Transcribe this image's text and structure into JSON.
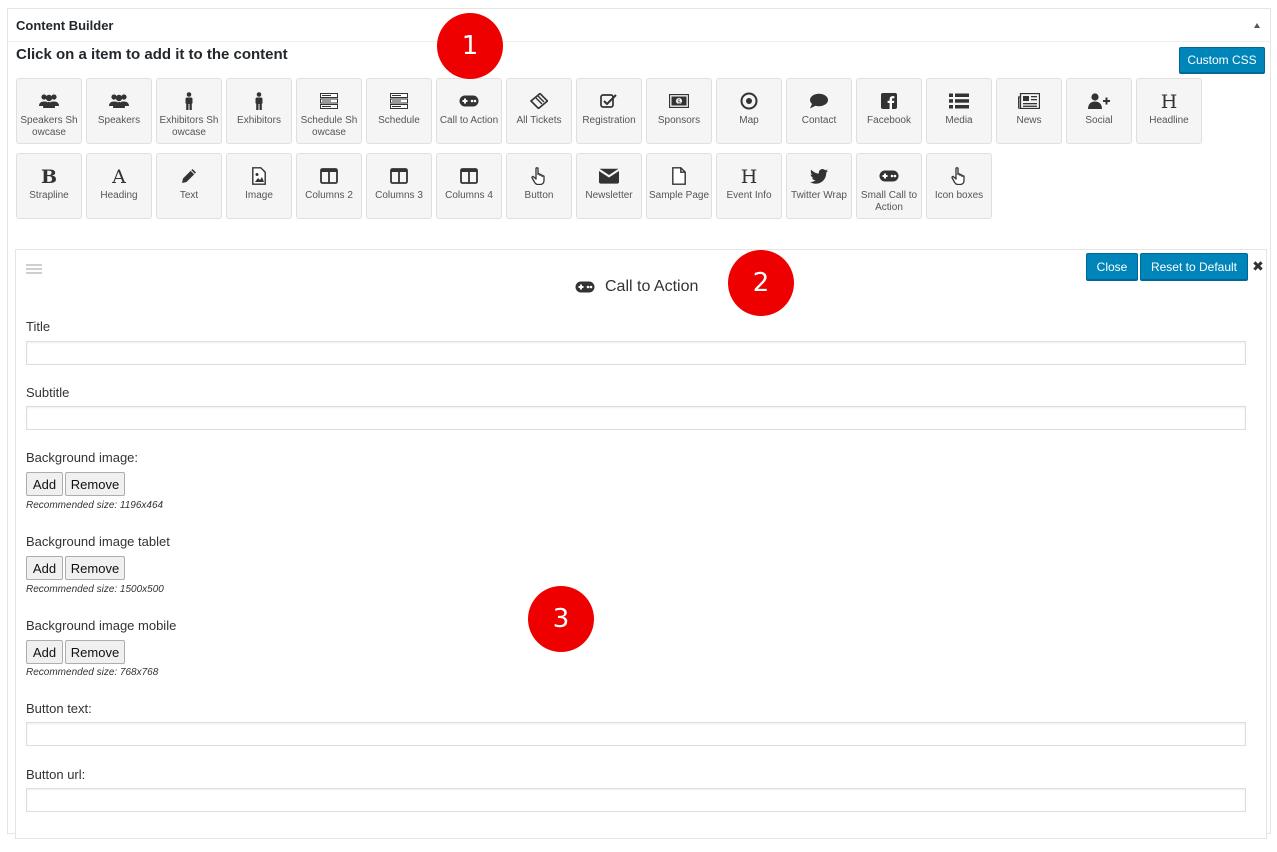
{
  "panel": {
    "title": "Content Builder"
  },
  "instruction": "Click on a item to add it to the content",
  "custom_css_label": "Custom CSS",
  "tiles_row1": [
    {
      "label": "Speakers Showcase",
      "icon": "users-icon"
    },
    {
      "label": "Speakers",
      "icon": "users-icon"
    },
    {
      "label": "Exhibitors Showcase",
      "icon": "person-icon"
    },
    {
      "label": "Exhibitors",
      "icon": "person-icon"
    },
    {
      "label": "Schedule Showcase",
      "icon": "server-icon"
    },
    {
      "label": "Schedule",
      "icon": "server-icon"
    },
    {
      "label": "Call to Action",
      "icon": "gamepad-icon"
    },
    {
      "label": "All Tickets",
      "icon": "ticket-icon"
    },
    {
      "label": "Registration",
      "icon": "checkbox-icon"
    },
    {
      "label": "Sponsors",
      "icon": "money-icon"
    },
    {
      "label": "Map",
      "icon": "target-icon"
    },
    {
      "label": "Contact",
      "icon": "comment-icon"
    },
    {
      "label": "Facebook",
      "icon": "facebook-icon"
    },
    {
      "label": "Media",
      "icon": "list-icon"
    },
    {
      "label": "News",
      "icon": "newspaper-icon"
    },
    {
      "label": "Social",
      "icon": "user-plus-icon"
    },
    {
      "label": "Headline",
      "icon": "header-icon"
    }
  ],
  "tiles_row2": [
    {
      "label": "Strapline",
      "icon": "bold-icon"
    },
    {
      "label": "Heading",
      "icon": "font-icon"
    },
    {
      "label": "Text",
      "icon": "pencil-icon"
    },
    {
      "label": "Image",
      "icon": "image-icon"
    },
    {
      "label": "Columns 2",
      "icon": "columns-icon"
    },
    {
      "label": "Columns 3",
      "icon": "columns-icon"
    },
    {
      "label": "Columns 4",
      "icon": "columns-icon"
    },
    {
      "label": "Button",
      "icon": "pointer-icon"
    },
    {
      "label": "Newsletter",
      "icon": "envelope-icon"
    },
    {
      "label": "Sample Page",
      "icon": "file-icon"
    },
    {
      "label": "Event Info",
      "icon": "header-icon"
    },
    {
      "label": "Twitter Wrap",
      "icon": "twitter-icon"
    },
    {
      "label": "Small Call to Action",
      "icon": "gamepad-icon"
    },
    {
      "label": "Icon boxes",
      "icon": "pointer-icon"
    }
  ],
  "badges": [
    "1",
    "2",
    "3"
  ],
  "editor": {
    "title": "Call to Action",
    "title_icon": "gamepad-icon",
    "close_label": "Close",
    "reset_label": "Reset to Default",
    "close_x": "✖",
    "fields": {
      "title_label": "Title",
      "title_value": "",
      "subtitle_label": "Subtitle",
      "subtitle_value": "",
      "bg_label": "Background image:",
      "bg_hint": "Recommended size: 1196x464",
      "bg_tablet_label": "Background image tablet",
      "bg_tablet_hint": "Recommended size: 1500x500",
      "bg_mobile_label": "Background image mobile",
      "bg_mobile_hint": "Recommended size: 768x768",
      "add_label": "Add",
      "remove_label": "Remove",
      "button_text_label": "Button text:",
      "button_text_value": "",
      "button_url_label": "Button url:",
      "button_url_value": ""
    }
  }
}
